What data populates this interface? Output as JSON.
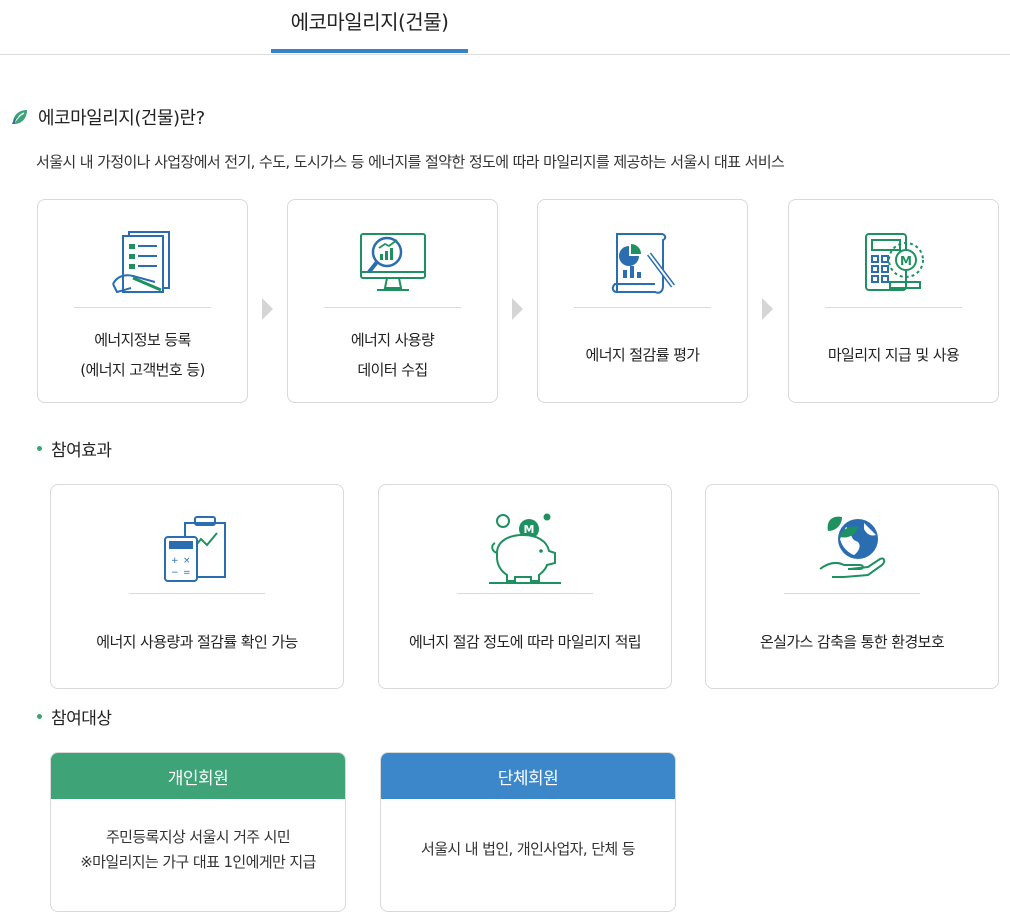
{
  "tab": {
    "label": "에코마일리지(건물)"
  },
  "intro": {
    "title": "에코마일리지(건물)란?",
    "description": "서울시 내 가정이나 사업장에서 전기, 수도, 도시가스 등 에너지를 절약한 정도에 따라 마일리지를 제공하는 서울시 대표 서비스"
  },
  "steps": [
    {
      "icon": "document-register-icon",
      "line1": "에너지정보 등록",
      "line2": "(에너지 고객번호 등)"
    },
    {
      "icon": "monitor-analytics-icon",
      "line1": "에너지 사용량",
      "line2": "데이터 수집"
    },
    {
      "icon": "report-evaluation-icon",
      "line1": "에너지 절감률 평가",
      "line2": ""
    },
    {
      "icon": "calculator-mileage-icon",
      "line1": "마일리지 지급 및 사용",
      "line2": ""
    }
  ],
  "effects": {
    "title": "참여효과",
    "items": [
      {
        "icon": "calculator-chart-icon",
        "label": "에너지 사용량과 절감률 확인 가능"
      },
      {
        "icon": "piggy-bank-icon",
        "label": "에너지 절감 정도에 따라 마일리지 적립"
      },
      {
        "icon": "earth-hand-icon",
        "label": "온실가스 감축을 통한 환경보호"
      }
    ]
  },
  "targets": {
    "title": "참여대상",
    "items": [
      {
        "label": "개인회원",
        "color": "#3ea377",
        "line1": "주민등록지상 서울시 거주 시민",
        "line2": "※마일리지는 가구 대표 1인에게만 지급"
      },
      {
        "label": "단체회원",
        "color": "#3b87c9",
        "line1": "서울시 내 법인, 개인사업자, 단체 등",
        "line2": ""
      }
    ]
  },
  "colors": {
    "accent_blue": "#3783c4",
    "green": "#3ea377",
    "icon_blue": "#2a6db0",
    "icon_green": "#1f9160"
  }
}
